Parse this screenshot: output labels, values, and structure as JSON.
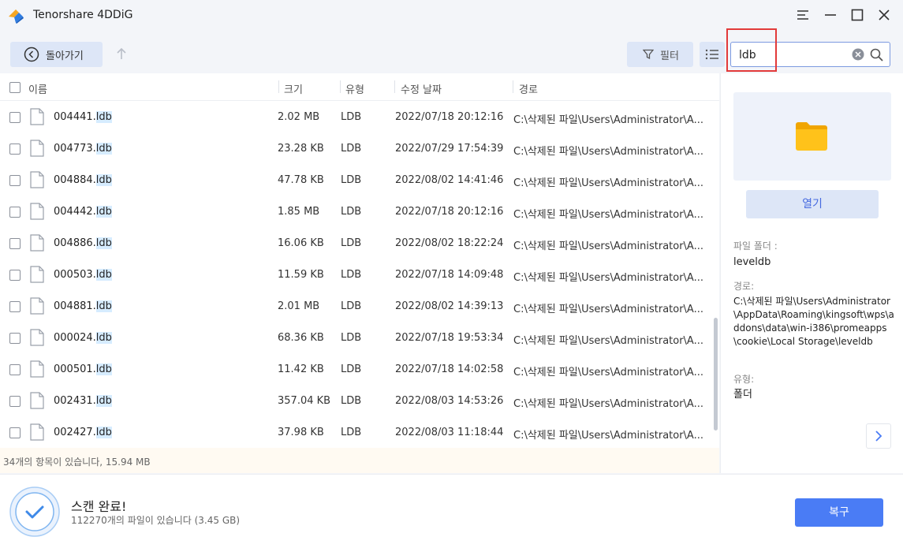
{
  "app": {
    "title": "Tenorshare 4DDiG"
  },
  "window_controls": [
    "menu-icon",
    "minimize-icon",
    "maximize-icon",
    "close-icon"
  ],
  "toolbar": {
    "back_label": "돌아가기",
    "filter_label": "필터",
    "search_value": "ldb"
  },
  "columns": {
    "name": "이름",
    "size": "크기",
    "type": "유형",
    "date": "수정 날짜",
    "path": "경로"
  },
  "files": [
    {
      "name_prefix": "004441.",
      "name_match": "ldb",
      "size": "2.02 MB",
      "type": "LDB",
      "date": "2022/07/18 20:12:16",
      "path": "C:\\삭제된 파일\\Users\\Administrator\\A..."
    },
    {
      "name_prefix": "004773.",
      "name_match": "ldb",
      "size": "23.28 KB",
      "type": "LDB",
      "date": "2022/07/29 17:54:39",
      "path": "C:\\삭제된 파일\\Users\\Administrator\\A..."
    },
    {
      "name_prefix": "004884.",
      "name_match": "ldb",
      "size": "47.78 KB",
      "type": "LDB",
      "date": "2022/08/02 14:41:46",
      "path": "C:\\삭제된 파일\\Users\\Administrator\\A..."
    },
    {
      "name_prefix": "004442.",
      "name_match": "ldb",
      "size": "1.85 MB",
      "type": "LDB",
      "date": "2022/07/18 20:12:16",
      "path": "C:\\삭제된 파일\\Users\\Administrator\\A..."
    },
    {
      "name_prefix": "004886.",
      "name_match": "ldb",
      "size": "16.06 KB",
      "type": "LDB",
      "date": "2022/08/02 18:22:24",
      "path": "C:\\삭제된 파일\\Users\\Administrator\\A..."
    },
    {
      "name_prefix": "000503.",
      "name_match": "ldb",
      "size": "11.59 KB",
      "type": "LDB",
      "date": "2022/07/18 14:09:48",
      "path": "C:\\삭제된 파일\\Users\\Administrator\\A..."
    },
    {
      "name_prefix": "004881.",
      "name_match": "ldb",
      "size": "2.01 MB",
      "type": "LDB",
      "date": "2022/08/02 14:39:13",
      "path": "C:\\삭제된 파일\\Users\\Administrator\\A..."
    },
    {
      "name_prefix": "000024.",
      "name_match": "ldb",
      "size": "68.36 KB",
      "type": "LDB",
      "date": "2022/07/18 19:53:34",
      "path": "C:\\삭제된 파일\\Users\\Administrator\\A..."
    },
    {
      "name_prefix": "000501.",
      "name_match": "ldb",
      "size": "11.42 KB",
      "type": "LDB",
      "date": "2022/07/18 14:02:58",
      "path": "C:\\삭제된 파일\\Users\\Administrator\\A..."
    },
    {
      "name_prefix": "002431.",
      "name_match": "ldb",
      "size": "357.04 KB",
      "type": "LDB",
      "date": "2022/08/03 14:53:26",
      "path": "C:\\삭제된 파일\\Users\\Administrator\\A..."
    },
    {
      "name_prefix": "002427.",
      "name_match": "ldb",
      "size": "37.98 KB",
      "type": "LDB",
      "date": "2022/08/03 11:18:44",
      "path": "C:\\삭제된 파일\\Users\\Administrator\\A..."
    }
  ],
  "list_footer": "34개의 항목이 있습니다, 15.94 MB",
  "preview": {
    "open_label": "열기",
    "folder_label": "파일 폴더 :",
    "folder_value": "leveldb",
    "path_label": "경로:",
    "path_value": "C:\\삭제된 파일\\Users\\Administrator\\AppData\\Roaming\\kingsoft\\wps\\addons\\data\\win-i386\\promeapps\\cookie\\Local Storage\\leveldb",
    "type_label": "유형:",
    "type_value": "폴더"
  },
  "status": {
    "title": "스캔 완료!",
    "subtitle": "112270개의 파일이 있습니다 (3.45 GB)",
    "recover_label": "복구"
  },
  "colors": {
    "accent": "#4a7cf5",
    "highlight_box": "#e23a3a",
    "match_highlight": "#d6ecff"
  }
}
